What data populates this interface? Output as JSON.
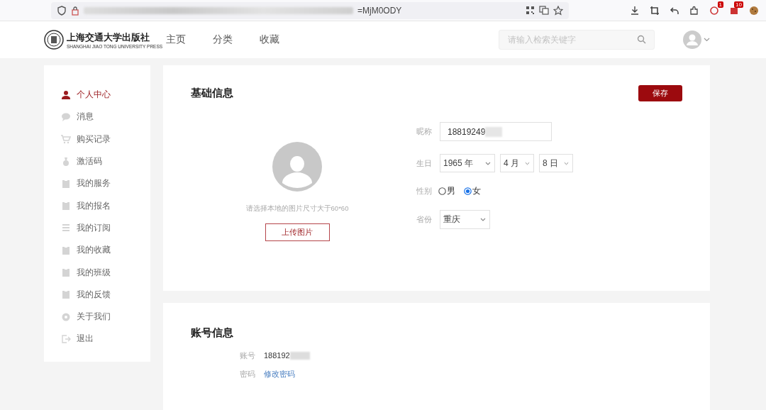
{
  "browser": {
    "url": "=MjM0ODY",
    "badges": [
      "1",
      "10"
    ]
  },
  "header": {
    "logo_title": "上海交通大学出版社",
    "logo_subtitle": "SHANGHAI JIAO TONG UNIVERSITY PRESS",
    "nav": [
      {
        "label": "主页"
      },
      {
        "label": "分类"
      },
      {
        "label": "收藏"
      }
    ],
    "search": {
      "placeholder": "请输入检索关键字"
    }
  },
  "sidebar": {
    "items": [
      {
        "label": "个人中心",
        "kind": "person",
        "selected": true
      },
      {
        "label": "消息",
        "kind": "chat",
        "selected": false
      },
      {
        "label": "购买记录",
        "kind": "cart",
        "selected": false
      },
      {
        "label": "激活码",
        "kind": "medal",
        "selected": false
      },
      {
        "label": "我的服务",
        "kind": "clipboard",
        "selected": false
      },
      {
        "label": "我的报名",
        "kind": "clipboard",
        "selected": false
      },
      {
        "label": "我的订阅",
        "kind": "list",
        "selected": false
      },
      {
        "label": "我的收藏",
        "kind": "clipboard",
        "selected": false
      },
      {
        "label": "我的班级",
        "kind": "clipboard",
        "selected": false
      },
      {
        "label": "我的反馈",
        "kind": "clipboard",
        "selected": false
      },
      {
        "label": "关于我们",
        "kind": "gear",
        "selected": false
      },
      {
        "label": "退出",
        "kind": "exit",
        "selected": false
      }
    ]
  },
  "basic_info": {
    "title": "基础信息",
    "save_button": "保存",
    "avatar_hint": "请选择本地的图片尺寸大于60*60",
    "upload_button": "上传图片",
    "fields": [
      {
        "kind": "text",
        "label": "昵称",
        "value": "18819249",
        "redacted": true
      },
      {
        "kind": "selects",
        "label": "生日",
        "options": [
          "1965 年",
          "4 月",
          "8 日"
        ]
      },
      {
        "kind": "radio",
        "label": "性别",
        "choices": [
          {
            "label": "男",
            "selected": false
          },
          {
            "label": "女",
            "selected": true
          }
        ]
      },
      {
        "kind": "select",
        "label": "省份",
        "value": "重庆"
      }
    ]
  },
  "account_info": {
    "title": "账号信息",
    "rows": [
      {
        "kind": "text",
        "label": "账号",
        "value": "188192",
        "redacted": true
      },
      {
        "kind": "link",
        "label": "密码",
        "value": "修改密码"
      }
    ]
  }
}
